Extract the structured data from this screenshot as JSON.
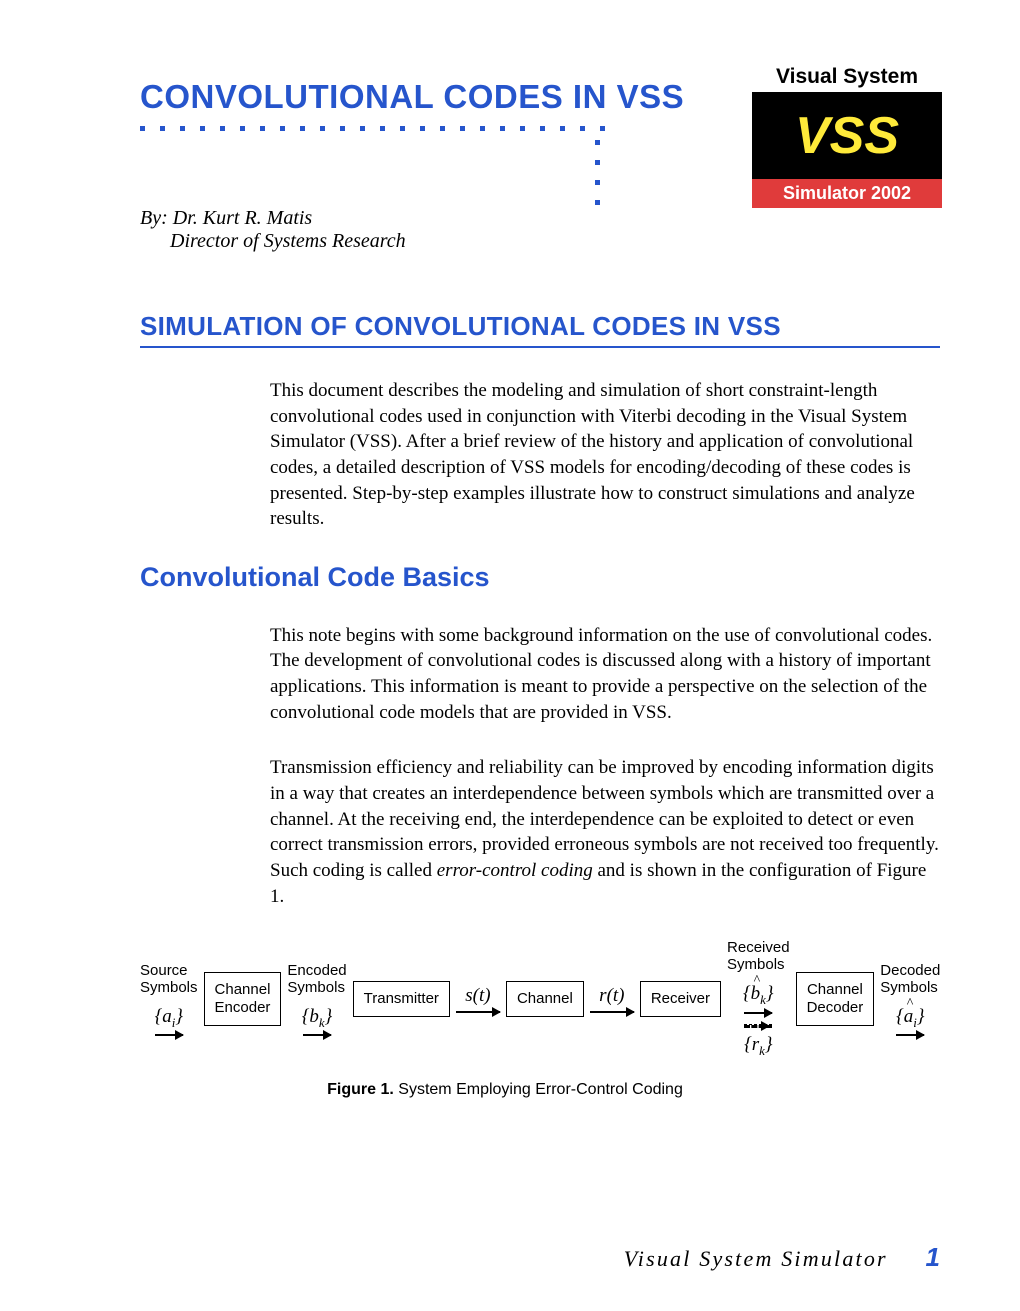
{
  "main_title": "CONVOLUTIONAL CODES IN VSS",
  "logo": {
    "top": "Visual System",
    "middle": "VSS",
    "bottom": "Simulator 2002"
  },
  "byline": {
    "by": "By: Dr. Kurt R. Matis",
    "role": "Director of Systems Research"
  },
  "section_title": "SIMULATION OF CONVOLUTIONAL CODES IN VSS",
  "intro_paragraph": "This document describes the modeling and simulation of short constraint-length convolutional codes used in conjunction with Viterbi decoding in the Visual System Simulator (VSS). After a brief review of the history and application of convolutional codes, a detailed description of VSS models for encoding/decoding of these codes is presented. Step-by-step examples illustrate how to construct simulations and analyze results.",
  "subsection_title": "Convolutional Code Basics",
  "basics_p1": "This note begins with some background information on the use of convolutional codes. The development of convolutional codes is discussed along with a history of important applications. This information is meant to provide a perspective on the selection of the convolutional code models that are provided in VSS.",
  "basics_p2_a": "Transmission efficiency and reliability can be improved by encoding information digits in a way that creates an interdependence between symbols which are transmitted over a channel. At the receiving end, the interdependence can be exploited to detect or even correct transmission errors, provided erroneous symbols are not received too frequently. Such coding is called ",
  "basics_p2_ital": "error-control coding",
  "basics_p2_b": " and is shown in the configuration of Figure 1.",
  "diagram": {
    "source_label": "Source\nSymbols",
    "source_sym": "{aᵢ}",
    "encoder_box": "Channel\nEncoder",
    "encoded_label": "Encoded\nSymbols",
    "encoded_sym": "{bₖ}",
    "tx_box": "Transmitter",
    "st": "s(t)",
    "channel_box": "Channel",
    "rt": "r(t)",
    "rx_box": "Receiver",
    "recv_label": "Received\nSymbols",
    "bhat": "{b̂ₖ}",
    "rk": "{rₖ}",
    "decoder_box": "Channel\nDecoder",
    "decoded_label": "Decoded\nSymbols",
    "ahat": "{âᵢ}"
  },
  "figure_caption_bold": "Figure 1.",
  "figure_caption_rest": "  System Employing Error-Control Coding",
  "footer_text": "Visual System Simulator",
  "page_number": "1"
}
